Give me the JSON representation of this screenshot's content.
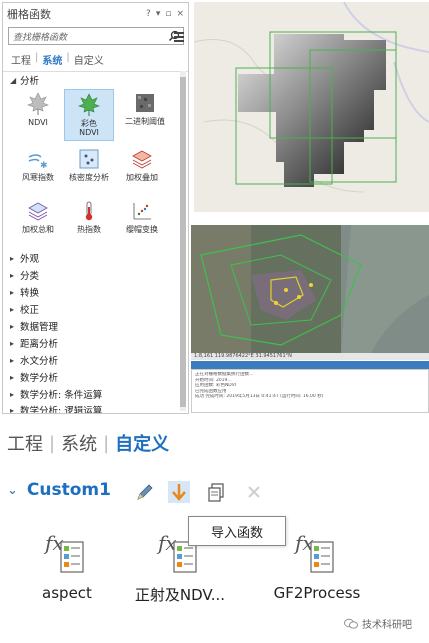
{
  "pane": {
    "title": "栅格函数",
    "controls": [
      "?",
      "▾",
      "▫",
      "×"
    ],
    "search_placeholder": "查找栅格函数",
    "tabs": [
      {
        "label": "工程",
        "active": false
      },
      {
        "label": "系统",
        "active": true
      },
      {
        "label": "自定义",
        "active": false
      }
    ],
    "expanded_group": "分析",
    "functions": [
      {
        "label": "NDVI",
        "icon": "ndvi-leaf-icon"
      },
      {
        "label": "彩色\nNDVI",
        "icon": "color-ndvi-leaf-icon",
        "selected": true
      },
      {
        "label": "二进制阈值",
        "icon": "binary-threshold-icon"
      },
      {
        "label": "风寒指数",
        "icon": "wind-chill-icon"
      },
      {
        "label": "核密度分析",
        "icon": "kernel-density-icon"
      },
      {
        "label": "加权叠加",
        "icon": "weighted-overlay-icon"
      },
      {
        "label": "加权总和",
        "icon": "weighted-sum-icon"
      },
      {
        "label": "热指数",
        "icon": "heat-index-icon"
      },
      {
        "label": "缨帽变换",
        "icon": "tasseled-cap-icon"
      }
    ],
    "groups": [
      "外观",
      "分类",
      "转换",
      "校正",
      "数据管理",
      "距离分析",
      "水文分析",
      "数学分析",
      "数学分析: 条件运算",
      "数学分析: 逻辑运算"
    ]
  },
  "map2": {
    "status": "1:8,161   119.9876422°E 31.9451761°N",
    "log_lines": [
      "正在对栅格数据集执行函数...",
      "开始时间: 2019...",
      "应用函数: 彩色NDVI",
      "已完成函数应用",
      "成功 完成时间: 2019年5月13日 0:41:47 (运行时间: 16.00 秒)"
    ]
  },
  "lower": {
    "tabs": [
      {
        "label": "工程",
        "active": false
      },
      {
        "label": "系统",
        "active": false
      },
      {
        "label": "自定义",
        "active": true
      }
    ],
    "category": "Custom1",
    "tooltip": "导入函数",
    "functions": [
      {
        "label": "aspect",
        "icon": "fx-function-icon"
      },
      {
        "label": "正射及NDV...",
        "icon": "fx-function-icon"
      },
      {
        "label": "GF2Process",
        "icon": "fx-function-icon"
      }
    ]
  },
  "watermark": "技术科研吧",
  "colors": {
    "accent": "#1d6fbf",
    "selected_bg": "#cde4f7",
    "import_bg": "#d6e8f7"
  }
}
